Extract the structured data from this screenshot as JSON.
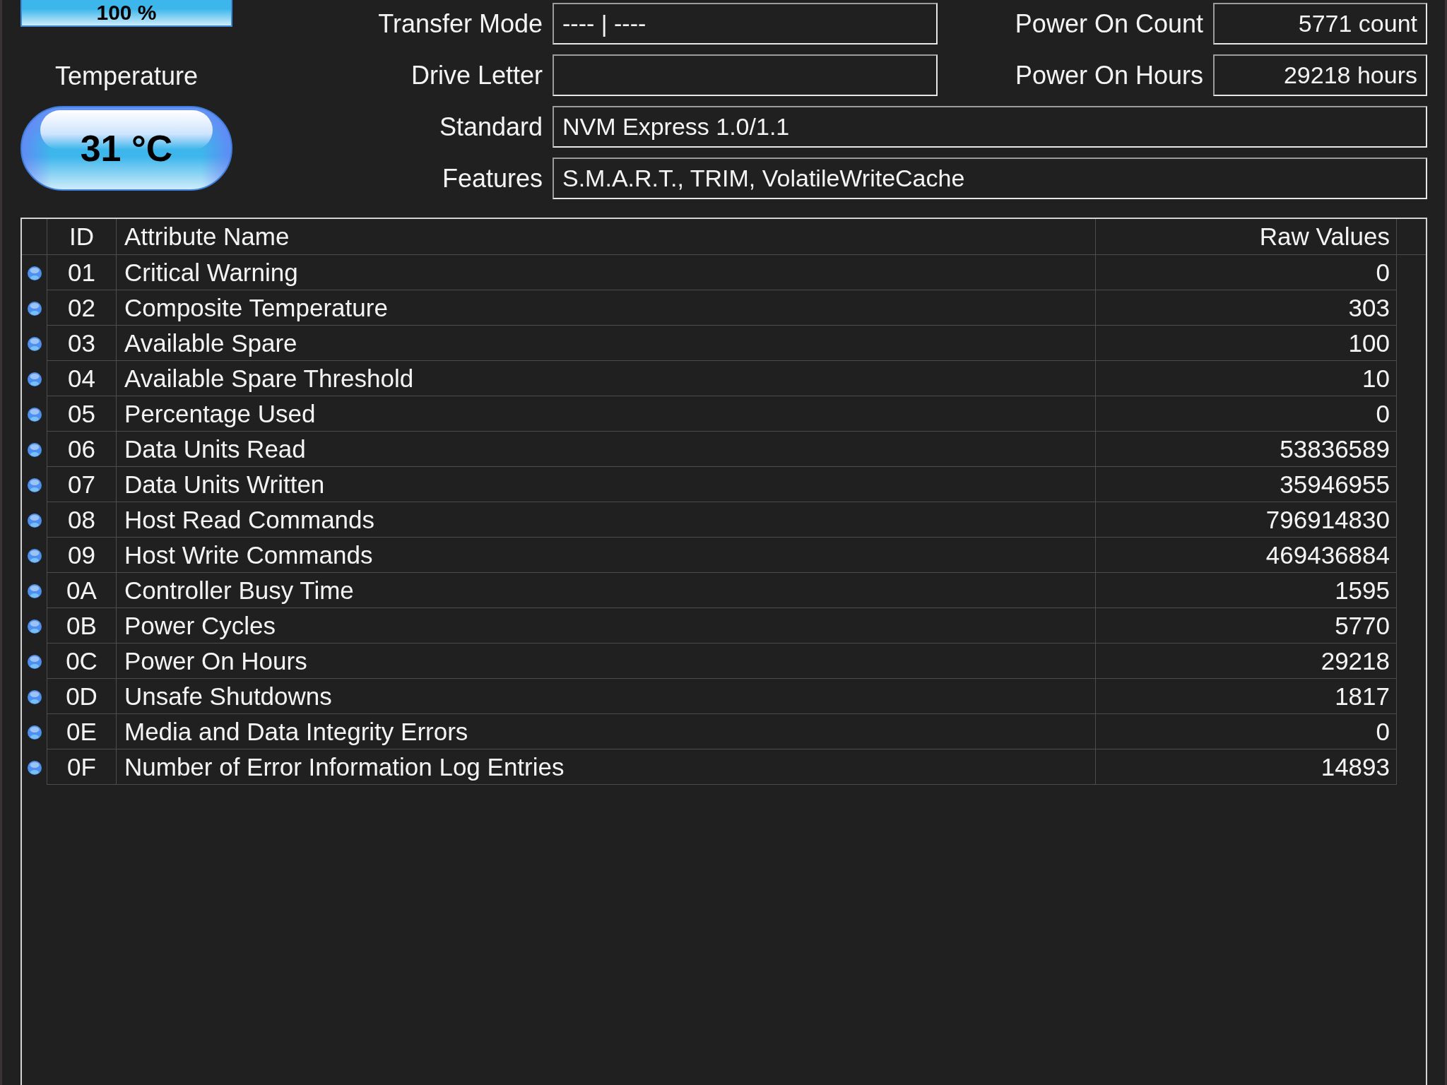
{
  "health": {
    "value": "100 %",
    "color": "#3db6ec"
  },
  "temperature": {
    "label": "Temperature",
    "value": "31 °C",
    "color": "#3db6ec"
  },
  "fields": [
    {
      "label": "Transfer Mode",
      "value": "---- | ----",
      "kind": "text"
    },
    {
      "label": "Power On Count",
      "value": "5771 count",
      "kind": "counter"
    },
    {
      "label": "Drive Letter",
      "kind": "text"
    },
    {
      "label": "Power On Hours",
      "value": "29218 hours",
      "kind": "counter"
    },
    {
      "label": "Standard",
      "value": "NVM Express 1.0/1.1",
      "kind": "wide"
    },
    {
      "label": "Features",
      "value": "S.M.A.R.T., TRIM, VolatileWriteCache",
      "kind": "wide"
    }
  ],
  "table": {
    "columns": [
      "ID",
      "Attribute Name",
      "Raw Values"
    ],
    "rows": [
      {
        "id": "01",
        "name": "Critical Warning",
        "raw": "0",
        "color": "#4d90ef"
      },
      {
        "id": "02",
        "name": "Composite Temperature",
        "raw": "303",
        "color": "#4d90ef"
      },
      {
        "id": "03",
        "name": "Available Spare",
        "raw": "100",
        "color": "#4d90ef"
      },
      {
        "id": "04",
        "name": "Available Spare Threshold",
        "raw": "10",
        "color": "#4d90ef"
      },
      {
        "id": "05",
        "name": "Percentage Used",
        "raw": "0",
        "color": "#4d90ef"
      },
      {
        "id": "06",
        "name": "Data Units Read",
        "raw": "53836589",
        "color": "#4d90ef"
      },
      {
        "id": "07",
        "name": "Data Units Written",
        "raw": "35946955",
        "color": "#4d90ef"
      },
      {
        "id": "08",
        "name": "Host Read Commands",
        "raw": "796914830",
        "color": "#4d90ef"
      },
      {
        "id": "09",
        "name": "Host Write Commands",
        "raw": "469436884",
        "color": "#4d90ef"
      },
      {
        "id": "0A",
        "name": "Controller Busy Time",
        "raw": "1595",
        "color": "#4d90ef"
      },
      {
        "id": "0B",
        "name": "Power Cycles",
        "raw": "5770",
        "color": "#4d90ef"
      },
      {
        "id": "0C",
        "name": "Power On Hours",
        "raw": "29218",
        "color": "#4d90ef"
      },
      {
        "id": "0D",
        "name": "Unsafe Shutdowns",
        "raw": "1817",
        "color": "#4d90ef"
      },
      {
        "id": "0E",
        "name": "Media and Data Integrity Errors",
        "raw": "0",
        "color": "#4d90ef"
      },
      {
        "id": "0F",
        "name": "Number of Error Information Log Entries",
        "raw": "14893",
        "color": "#4d90ef"
      }
    ]
  }
}
